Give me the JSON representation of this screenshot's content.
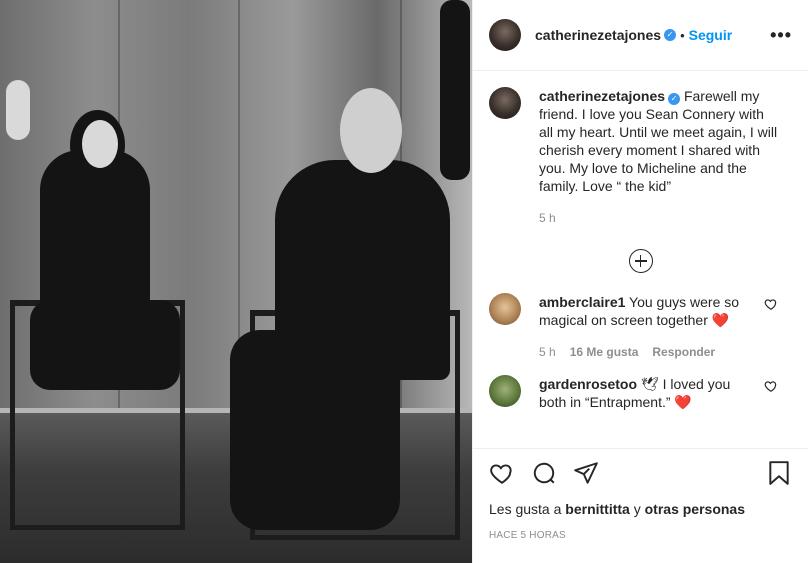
{
  "post": {
    "author": {
      "username": "catherinezetajones",
      "verified_icon": "verified-badge-icon",
      "separator": "•",
      "follow_label": "Seguir",
      "more_icon": "more-options-icon",
      "more_label": "•••"
    },
    "caption": {
      "username": "catherinezetajones",
      "text": "Farewell my friend. I love you Sean Connery with all my heart. Until we meet again, I will cherish every moment I shared with you. My love to Micheline and the family. Love “ the kid”",
      "time": "5 h"
    },
    "load_more_icon": "plus-circle-icon",
    "comments": [
      {
        "username": "amberclaire1",
        "text": "You guys were so magical on screen together",
        "emoji": "❤️",
        "time": "5 h",
        "likes": "16 Me gusta",
        "reply_label": "Responder"
      },
      {
        "username": "gardenrosetoo",
        "emoji_prefix": "🕊",
        "text": "I loved you both in “Entrapment.”",
        "emoji": "❤️"
      }
    ],
    "actions": {
      "like_icon": "heart-icon",
      "comment_icon": "comment-icon",
      "share_icon": "share-icon",
      "save_icon": "bookmark-icon"
    },
    "likes": {
      "prefix": "Les gusta a",
      "first": "bernittitta",
      "connector": "y",
      "others": "otras personas"
    },
    "time_ago": "HACE 5 HORAS"
  },
  "colors": {
    "link_blue": "#0095f6",
    "text": "#262626",
    "muted": "#8e8e8e",
    "heart_red": "#ed4956"
  }
}
